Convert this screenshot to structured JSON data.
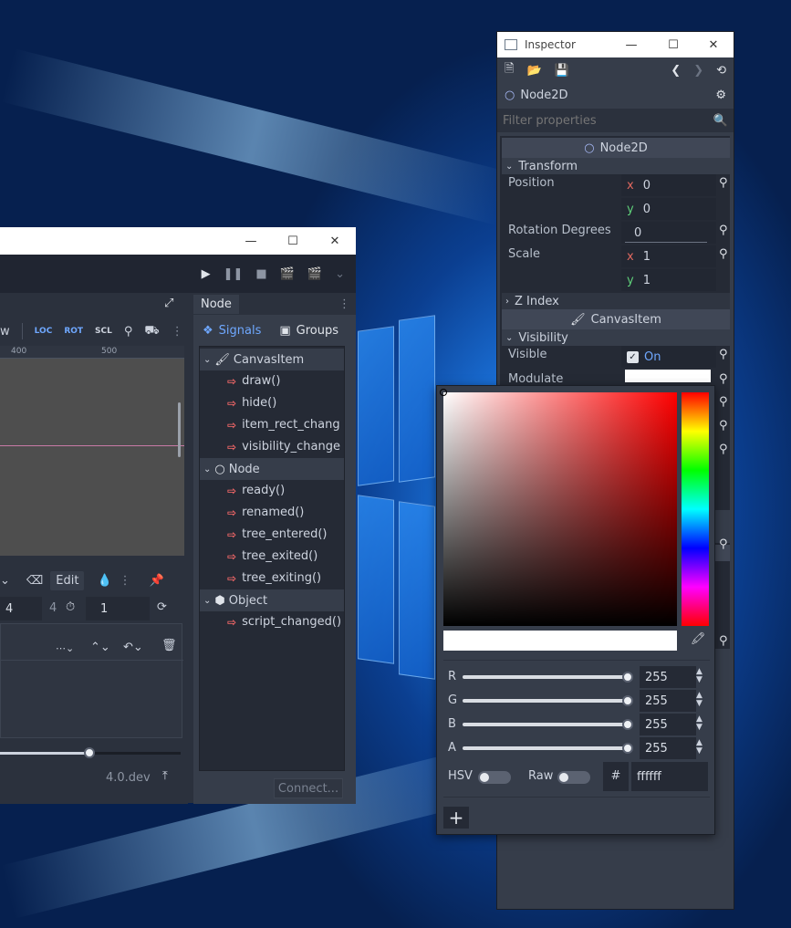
{
  "desktop": {
    "accent": "#1a6fd6"
  },
  "editor_window": {
    "toolbar_icons": [
      "play-icon",
      "pause-icon",
      "stop-icon",
      "play-scene-icon",
      "play-custom-scene-icon",
      "chevron-down-icon"
    ],
    "viewport_tools": {
      "partial_label": "w",
      "loc": "LOC",
      "rot": "ROT",
      "scl": "SCL"
    },
    "ruler": {
      "tick_400": "400",
      "tick_500": "500"
    },
    "anim_toolbar": {
      "edit_label": "Edit",
      "length_value": "4",
      "length_step": "4",
      "snap_value": "1"
    },
    "version": "4.0.dev"
  },
  "node_dock": {
    "tab": "Node",
    "signals_tab": "Signals",
    "groups_tab": "Groups",
    "sections": [
      {
        "name": "CanvasItem",
        "signals": [
          "draw()",
          "hide()",
          "item_rect_chang",
          "visibility_change"
        ]
      },
      {
        "name": "Node",
        "signals": [
          "ready()",
          "renamed()",
          "tree_entered()",
          "tree_exited()",
          "tree_exiting()"
        ]
      },
      {
        "name": "Object",
        "signals": [
          "script_changed()"
        ]
      }
    ],
    "connect_button": "Connect..."
  },
  "inspector": {
    "title": "Inspector",
    "node_name": "Node2D",
    "filter_placeholder": "Filter properties",
    "class_header": "Node2D",
    "transform_label": "Transform",
    "position_label": "Position",
    "position": {
      "x_label": "x",
      "x": "0",
      "y_label": "y",
      "y": "0"
    },
    "rotation_label": "Rotation Degrees",
    "rotation": "0",
    "scale_label": "Scale",
    "scale": {
      "x_label": "x",
      "x": "1",
      "y_label": "y",
      "y": "1"
    },
    "z_index_label": "Z Index",
    "canvasitem_header": "CanvasItem",
    "visibility_label": "Visibility",
    "visible_label": "Visible",
    "visible_value": "On",
    "modulate_label": "Modulate",
    "modulate_color": "#ffffff"
  },
  "color_picker": {
    "current_color": "#ffffff",
    "channels": [
      {
        "label": "R",
        "value": "255",
        "level": 1.0
      },
      {
        "label": "G",
        "value": "255",
        "level": 1.0
      },
      {
        "label": "B",
        "value": "255",
        "level": 1.0
      },
      {
        "label": "A",
        "value": "255",
        "level": 1.0
      }
    ],
    "hsv_label": "HSV",
    "raw_label": "Raw",
    "hash_label": "#",
    "hex_value": "ffffff",
    "add_preset_label": "+"
  }
}
